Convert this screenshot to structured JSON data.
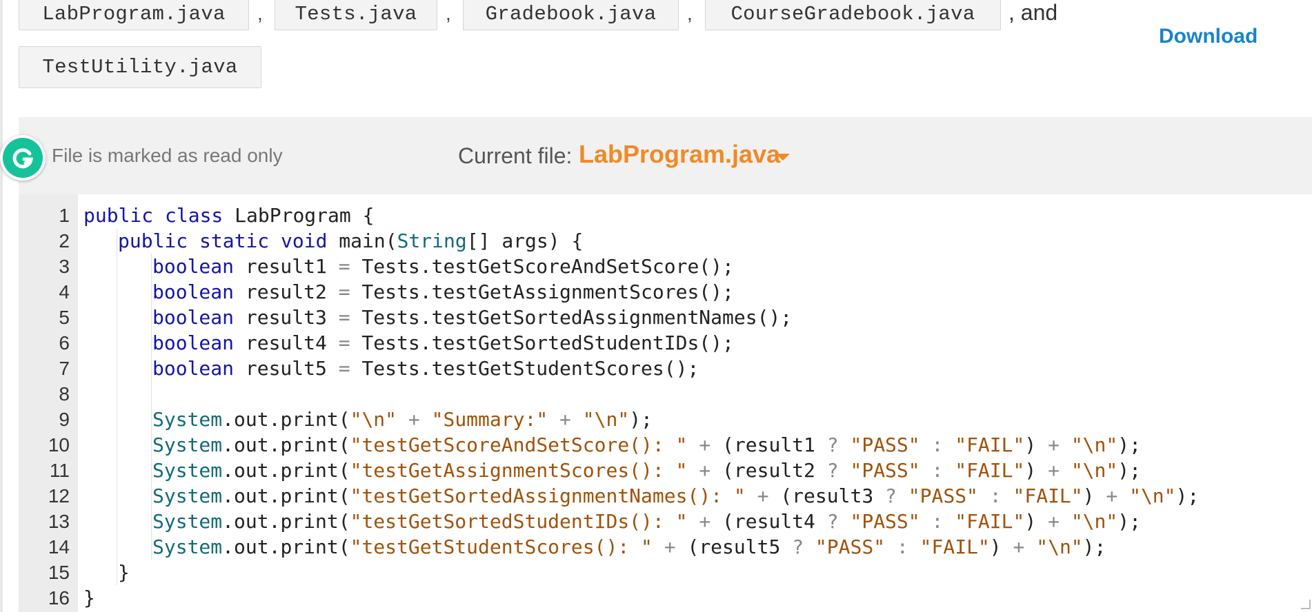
{
  "files_intro": {
    "files": [
      {
        "name": "LabProgram.java"
      },
      {
        "name": "Tests.java"
      },
      {
        "name": "Gradebook.java"
      },
      {
        "name": "CourseGradebook.java"
      },
      {
        "name": "TestUtility.java"
      }
    ],
    "separator": ",",
    "and_text": ", and"
  },
  "download_label": "Download",
  "editor": {
    "readonly_note": "File is marked as read only",
    "current_file_label": "Current file:",
    "current_file": "LabProgram.java",
    "grammarly_icon": "grammarly-icon",
    "lines": [
      {
        "n": "1",
        "indent": 0,
        "tokens": [
          {
            "t": "kw",
            "v": "public class "
          },
          {
            "t": "plain",
            "v": "LabProgram {"
          }
        ]
      },
      {
        "n": "2",
        "indent": 1,
        "tokens": [
          {
            "t": "kw",
            "v": "public static void "
          },
          {
            "t": "plain",
            "v": "main("
          },
          {
            "t": "type",
            "v": "String"
          },
          {
            "t": "plain",
            "v": "[] args) {"
          }
        ]
      },
      {
        "n": "3",
        "indent": 2,
        "tokens": [
          {
            "t": "kw",
            "v": "boolean "
          },
          {
            "t": "plain",
            "v": "result1 "
          },
          {
            "t": "op",
            "v": "="
          },
          {
            "t": "plain",
            "v": " Tests.testGetScoreAndSetScore();"
          }
        ]
      },
      {
        "n": "4",
        "indent": 2,
        "tokens": [
          {
            "t": "kw",
            "v": "boolean "
          },
          {
            "t": "plain",
            "v": "result2 "
          },
          {
            "t": "op",
            "v": "="
          },
          {
            "t": "plain",
            "v": " Tests.testGetAssignmentScores();"
          }
        ]
      },
      {
        "n": "5",
        "indent": 2,
        "tokens": [
          {
            "t": "kw",
            "v": "boolean "
          },
          {
            "t": "plain",
            "v": "result3 "
          },
          {
            "t": "op",
            "v": "="
          },
          {
            "t": "plain",
            "v": " Tests.testGetSortedAssignmentNames();"
          }
        ]
      },
      {
        "n": "6",
        "indent": 2,
        "tokens": [
          {
            "t": "kw",
            "v": "boolean "
          },
          {
            "t": "plain",
            "v": "result4 "
          },
          {
            "t": "op",
            "v": "="
          },
          {
            "t": "plain",
            "v": " Tests.testGetSortedStudentIDs();"
          }
        ]
      },
      {
        "n": "7",
        "indent": 2,
        "tokens": [
          {
            "t": "kw",
            "v": "boolean "
          },
          {
            "t": "plain",
            "v": "result5 "
          },
          {
            "t": "op",
            "v": "="
          },
          {
            "t": "plain",
            "v": " Tests.testGetStudentScores();"
          }
        ]
      },
      {
        "n": "8",
        "indent": 2,
        "tokens": []
      },
      {
        "n": "9",
        "indent": 2,
        "tokens": [
          {
            "t": "type",
            "v": "System"
          },
          {
            "t": "plain",
            "v": ".out.print("
          },
          {
            "t": "str",
            "v": "\"\\n\""
          },
          {
            "t": "op",
            "v": " + "
          },
          {
            "t": "str",
            "v": "\"Summary:\""
          },
          {
            "t": "op",
            "v": " + "
          },
          {
            "t": "str",
            "v": "\"\\n\""
          },
          {
            "t": "plain",
            "v": ");"
          }
        ]
      },
      {
        "n": "10",
        "indent": 2,
        "tokens": [
          {
            "t": "type",
            "v": "System"
          },
          {
            "t": "plain",
            "v": ".out.print("
          },
          {
            "t": "str",
            "v": "\"testGetScoreAndSetScore(): \""
          },
          {
            "t": "op",
            "v": " + "
          },
          {
            "t": "plain",
            "v": "(result1 "
          },
          {
            "t": "op",
            "v": "?"
          },
          {
            "t": "plain",
            "v": " "
          },
          {
            "t": "str",
            "v": "\"PASS\""
          },
          {
            "t": "op",
            "v": " : "
          },
          {
            "t": "str",
            "v": "\"FAIL\""
          },
          {
            "t": "plain",
            "v": ")"
          },
          {
            "t": "op",
            "v": " + "
          },
          {
            "t": "str",
            "v": "\"\\n\""
          },
          {
            "t": "plain",
            "v": ");"
          }
        ]
      },
      {
        "n": "11",
        "indent": 2,
        "tokens": [
          {
            "t": "type",
            "v": "System"
          },
          {
            "t": "plain",
            "v": ".out.print("
          },
          {
            "t": "str",
            "v": "\"testGetAssignmentScores(): \""
          },
          {
            "t": "op",
            "v": " + "
          },
          {
            "t": "plain",
            "v": "(result2 "
          },
          {
            "t": "op",
            "v": "?"
          },
          {
            "t": "plain",
            "v": " "
          },
          {
            "t": "str",
            "v": "\"PASS\""
          },
          {
            "t": "op",
            "v": " : "
          },
          {
            "t": "str",
            "v": "\"FAIL\""
          },
          {
            "t": "plain",
            "v": ")"
          },
          {
            "t": "op",
            "v": " + "
          },
          {
            "t": "str",
            "v": "\"\\n\""
          },
          {
            "t": "plain",
            "v": ");"
          }
        ]
      },
      {
        "n": "12",
        "indent": 2,
        "tokens": [
          {
            "t": "type",
            "v": "System"
          },
          {
            "t": "plain",
            "v": ".out.print("
          },
          {
            "t": "str",
            "v": "\"testGetSortedAssignmentNames(): \""
          },
          {
            "t": "op",
            "v": " + "
          },
          {
            "t": "plain",
            "v": "(result3 "
          },
          {
            "t": "op",
            "v": "?"
          },
          {
            "t": "plain",
            "v": " "
          },
          {
            "t": "str",
            "v": "\"PASS\""
          },
          {
            "t": "op",
            "v": " : "
          },
          {
            "t": "str",
            "v": "\"FAIL\""
          },
          {
            "t": "plain",
            "v": ")"
          },
          {
            "t": "op",
            "v": " + "
          },
          {
            "t": "str",
            "v": "\"\\n\""
          },
          {
            "t": "plain",
            "v": ");"
          }
        ]
      },
      {
        "n": "13",
        "indent": 2,
        "tokens": [
          {
            "t": "type",
            "v": "System"
          },
          {
            "t": "plain",
            "v": ".out.print("
          },
          {
            "t": "str",
            "v": "\"testGetSortedStudentIDs(): \""
          },
          {
            "t": "op",
            "v": " + "
          },
          {
            "t": "plain",
            "v": "(result4 "
          },
          {
            "t": "op",
            "v": "?"
          },
          {
            "t": "plain",
            "v": " "
          },
          {
            "t": "str",
            "v": "\"PASS\""
          },
          {
            "t": "op",
            "v": " : "
          },
          {
            "t": "str",
            "v": "\"FAIL\""
          },
          {
            "t": "plain",
            "v": ")"
          },
          {
            "t": "op",
            "v": " + "
          },
          {
            "t": "str",
            "v": "\"\\n\""
          },
          {
            "t": "plain",
            "v": ");"
          }
        ]
      },
      {
        "n": "14",
        "indent": 2,
        "tokens": [
          {
            "t": "type",
            "v": "System"
          },
          {
            "t": "plain",
            "v": ".out.print("
          },
          {
            "t": "str",
            "v": "\"testGetStudentScores(): \""
          },
          {
            "t": "op",
            "v": " + "
          },
          {
            "t": "plain",
            "v": "(result5 "
          },
          {
            "t": "op",
            "v": "?"
          },
          {
            "t": "plain",
            "v": " "
          },
          {
            "t": "str",
            "v": "\"PASS\""
          },
          {
            "t": "op",
            "v": " : "
          },
          {
            "t": "str",
            "v": "\"FAIL\""
          },
          {
            "t": "plain",
            "v": ")"
          },
          {
            "t": "op",
            "v": " + "
          },
          {
            "t": "str",
            "v": "\"\\n\""
          },
          {
            "t": "plain",
            "v": ");"
          }
        ]
      },
      {
        "n": "15",
        "indent": 1,
        "tokens": [
          {
            "t": "plain",
            "v": "}"
          }
        ]
      },
      {
        "n": "16",
        "indent": 0,
        "tokens": [
          {
            "t": "plain",
            "v": "}"
          }
        ]
      }
    ]
  },
  "colors": {
    "accent_orange": "#f08a24",
    "link_blue": "#1a83c8",
    "grammarly_green": "#15c39a"
  }
}
